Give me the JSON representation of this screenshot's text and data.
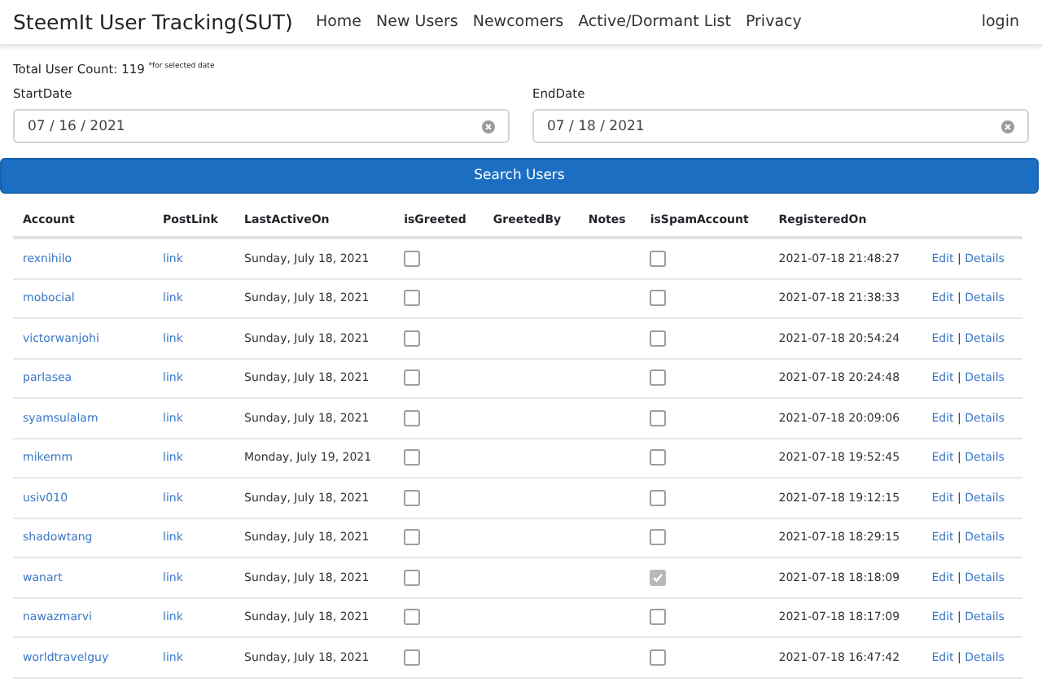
{
  "navbar": {
    "brand": "SteemIt User Tracking(SUT)",
    "links": [
      "Home",
      "New Users",
      "Newcomers",
      "Active/Dormant List",
      "Privacy"
    ],
    "login": "login"
  },
  "total": "Total User Count: 119 $^{*for selected date}$",
  "start": {
    "label": "StartDate",
    "value": "07 / 16 / 2021"
  },
  "end": {
    "label": "EndDate",
    "value": "07 / 18 / 2021"
  },
  "search_button": "Search Users",
  "table": {
    "columns": [
      "Account",
      "PostLink",
      "LastActiveOn",
      "isGreeted",
      "GreetedBy",
      "Notes",
      "isSpamAccount",
      "RegisteredOn"
    ],
    "rows": [
      {
        "account": "rexnihilo",
        "post": "link",
        "last_active": "Sunday, July 18, 2021",
        "is_greeted": false,
        "is_spam": false,
        "registered": "2021-07-18 21:48:27",
        "edit": "Edit",
        "separator": "|",
        "details": "Details"
      },
      {
        "account": "mobocial",
        "post": "link",
        "last_active": "Sunday, July 18, 2021",
        "is_greeted": false,
        "is_spam": false,
        "registered": "2021-07-18 21:38:33",
        "edit": "Edit",
        "separator": "|",
        "details": "Details"
      },
      {
        "account": "victorwanjohi",
        "post": "link",
        "last_active": "Sunday, July 18, 2021",
        "is_greeted": false,
        "is_spam": false,
        "registered": "2021-07-18 20:54:24",
        "edit": "Edit",
        "separator": "|",
        "details": "Details"
      },
      {
        "account": "parlasea",
        "post": "link",
        "last_active": "Sunday, July 18, 2021",
        "is_greeted": false,
        "is_spam": false,
        "registered": "2021-07-18 20:24:48",
        "edit": "Edit",
        "separator": "|",
        "details": "Details"
      },
      {
        "account": "syamsulalam",
        "post": "link",
        "last_active": "Sunday, July 18, 2021",
        "is_greeted": false,
        "is_spam": false,
        "registered": "2021-07-18 20:09:06",
        "edit": "Edit",
        "separator": "|",
        "details": "Details"
      },
      {
        "account": "mikemm",
        "post": "link",
        "last_active": "Monday, July 19, 2021",
        "is_greeted": false,
        "is_spam": false,
        "registered": "2021-07-18 19:52:45",
        "edit": "Edit",
        "separator": "|",
        "details": "Details"
      },
      {
        "account": "usiv010",
        "post": "link",
        "last_active": "Sunday, July 18, 2021",
        "is_greeted": false,
        "is_spam": false,
        "registered": "2021-07-18 19:12:15",
        "edit": "Edit",
        "separator": "|",
        "details": "Details"
      },
      {
        "account": "shadowtang",
        "post": "link",
        "last_active": "Sunday, July 18, 2021",
        "is_greeted": false,
        "is_spam": false,
        "registered": "2021-07-18 18:29:15",
        "edit": "Edit",
        "separator": "|",
        "details": "Details"
      },
      {
        "account": "wanart",
        "post": "link",
        "last_active": "Sunday, July 18, 2021",
        "is_greeted": false,
        "is_spam": true,
        "registered": "2021-07-18 18:18:09",
        "edit": "Edit",
        "separator": "|",
        "details": "Details"
      },
      {
        "account": "nawazmarvi",
        "post": "link",
        "last_active": "Sunday, July 18, 2021",
        "is_greeted": false,
        "is_spam": false,
        "registered": "2021-07-18 18:17:09",
        "edit": "Edit",
        "separator": "|",
        "details": "Details"
      },
      {
        "account": "worldtravelguy",
        "post": "link",
        "last_active": "Sunday, July 18, 2021",
        "is_greeted": false,
        "is_spam": false,
        "registered": "2021-07-18 16:47:42",
        "edit": "Edit",
        "separator": "|",
        "details": "Details"
      }
    ]
  }
}
